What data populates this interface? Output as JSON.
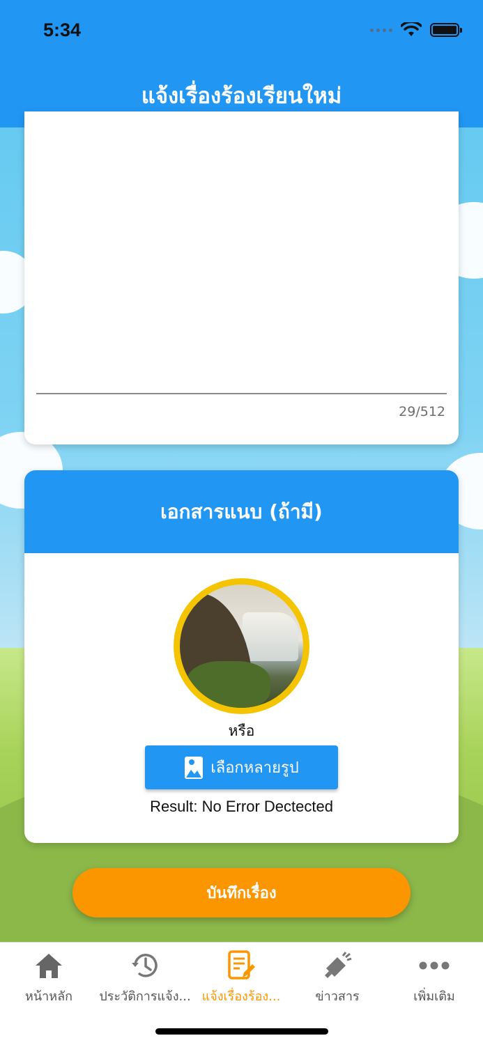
{
  "status_bar": {
    "time": "5:34"
  },
  "header": {
    "title": "แจ้งเรื่องร้องเรียนใหม่"
  },
  "complaint_text": {
    "value": "",
    "counter": "29/512"
  },
  "attachment": {
    "title": "เอกสารแนบ (ถ้ามี)",
    "or_label": "หรือ",
    "pick_button_label": "เลือกหลายรูป",
    "pick_button_icon": "image-icon",
    "result_text": "Result: No Error Dectected"
  },
  "save_button_label": "บันทึกเรื่อง",
  "colors": {
    "primary": "#2196f3",
    "accent": "#fb9600",
    "photo_border": "#f5c400"
  },
  "tabs": [
    {
      "label": "หน้าหลัก",
      "icon": "home-icon",
      "active": false
    },
    {
      "label": "ประวัติการแจ้ง...",
      "icon": "history-icon",
      "active": false
    },
    {
      "label": "แจ้งเรื่องร้อง...",
      "icon": "edit-document-icon",
      "active": true
    },
    {
      "label": "ข่าวสาร",
      "icon": "megaphone-icon",
      "active": false
    },
    {
      "label": "เพิ่มเติม",
      "icon": "more-icon",
      "active": false
    }
  ]
}
